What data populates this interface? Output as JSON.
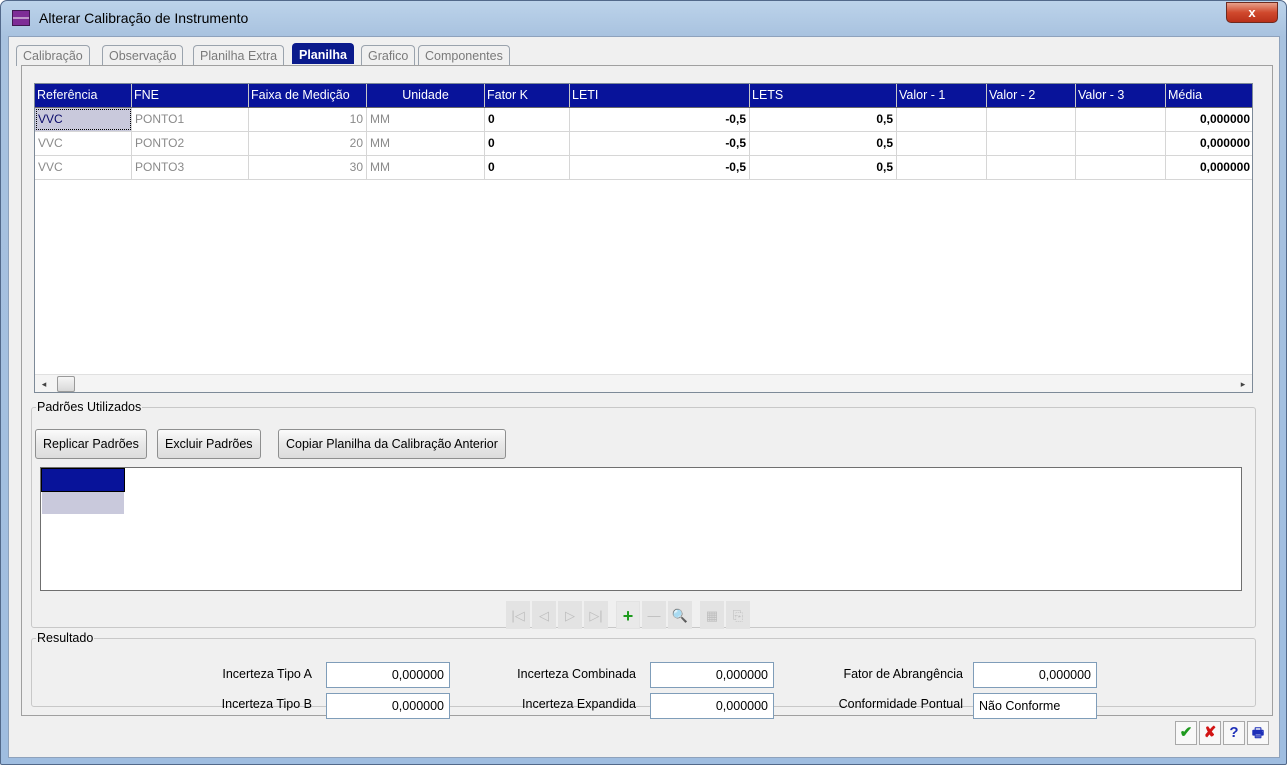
{
  "window": {
    "title": "Alterar Calibração de Instrumento",
    "close_glyph": "x"
  },
  "tabs": [
    {
      "label": "Calibração",
      "active": false
    },
    {
      "label": "Observação",
      "active": false
    },
    {
      "label": "Planilha Extra",
      "active": false
    },
    {
      "label": "Planilha",
      "active": true
    },
    {
      "label": "Grafico",
      "active": false
    },
    {
      "label": "Componentes",
      "active": false
    }
  ],
  "grid": {
    "headers": [
      "Referência",
      "FNE",
      "Faixa de Medição",
      "Unidade",
      "Fator K",
      "LETI",
      "LETS",
      "Valor - 1",
      "Valor - 2",
      "Valor - 3",
      "Média"
    ],
    "rows": [
      [
        "VVC",
        "PONTO1",
        "10",
        "MM",
        "0",
        "-0,5",
        "0,5",
        "",
        "",
        "",
        "0,000000"
      ],
      [
        "VVC",
        "PONTO2",
        "20",
        "MM",
        "0",
        "-0,5",
        "0,5",
        "",
        "",
        "",
        "0,000000"
      ],
      [
        "VVC",
        "PONTO3",
        "30",
        "MM",
        "0",
        "-0,5",
        "0,5",
        "",
        "",
        "",
        "0,000000"
      ]
    ],
    "scroll_left": "◂",
    "scroll_right": "▸"
  },
  "standards": {
    "legend": "Padrões Utilizados",
    "replicate_label": "Replicar Padrões",
    "delete_label": "Excluir Padrões",
    "copy_label": "Copiar Planilha da Calibração Anterior"
  },
  "navigator": {
    "first": "|◁",
    "prior": "◁",
    "next": "▷",
    "last": "▷|",
    "insert": "+",
    "delete": "—",
    "search": "🔍",
    "grid": "▦",
    "export": "⎘"
  },
  "result": {
    "legend": "Resultado",
    "tipo_a_label": "Incerteza Tipo A",
    "tipo_a_value": "0,000000",
    "tipo_b_label": "Incerteza Tipo B",
    "tipo_b_value": "0,000000",
    "combinada_label": "Incerteza Combinada",
    "combinada_value": "0,000000",
    "expandida_label": "Incerteza Expandida",
    "expandida_value": "0,000000",
    "abrangencia_label": "Fator de Abrangência",
    "abrangencia_value": "0,000000",
    "conformidade_label": "Conformidade Pontual",
    "conformidade_value": "Não Conforme"
  },
  "actions": {
    "ok": "✔",
    "cancel": "✘",
    "help": "?",
    "print": "🖶"
  }
}
